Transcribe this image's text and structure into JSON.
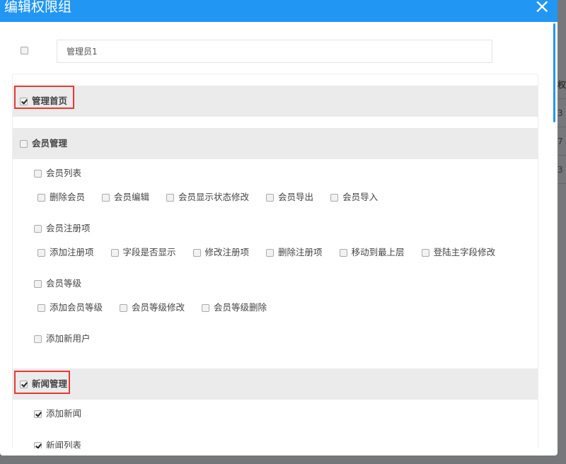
{
  "dialog": {
    "title": "编辑权限组",
    "close_icon": "×"
  },
  "group": {
    "name": "管理员1",
    "checked": false
  },
  "background_table": {
    "header": "权限",
    "cells": [
      "3",
      "7",
      "3"
    ]
  },
  "colors": {
    "header": "#2196f3",
    "highlight": "#e53935"
  },
  "sections": [
    {
      "label": "管理首页",
      "checked": true,
      "highlighted": true,
      "children": []
    },
    {
      "label": "会员管理",
      "checked": false,
      "highlighted": false,
      "children": [
        {
          "label": "会员列表",
          "checked": false,
          "items": [
            {
              "label": "删除会员",
              "checked": false
            },
            {
              "label": "会员编辑",
              "checked": false
            },
            {
              "label": "会员显示状态修改",
              "checked": false
            },
            {
              "label": "会员导出",
              "checked": false
            },
            {
              "label": "会员导入",
              "checked": false
            }
          ]
        },
        {
          "label": "会员注册项",
          "checked": false,
          "items": [
            {
              "label": "添加注册项",
              "checked": false
            },
            {
              "label": "字段是否显示",
              "checked": false
            },
            {
              "label": "修改注册项",
              "checked": false
            },
            {
              "label": "删除注册项",
              "checked": false
            },
            {
              "label": "移动到最上层",
              "checked": false
            },
            {
              "label": "登陆主字段修改",
              "checked": false
            }
          ]
        },
        {
          "label": "会员等级",
          "checked": false,
          "items": [
            {
              "label": "添加会员等级",
              "checked": false
            },
            {
              "label": "会员等级修改",
              "checked": false
            },
            {
              "label": "会员等级删除",
              "checked": false
            }
          ]
        },
        {
          "label": "添加新用户",
          "checked": false,
          "items": []
        }
      ]
    },
    {
      "label": "新闻管理",
      "checked": true,
      "highlighted": true,
      "children": [
        {
          "label": "添加新闻",
          "checked": true,
          "items": []
        },
        {
          "label": "新闻列表",
          "checked": true,
          "items": []
        }
      ]
    }
  ]
}
